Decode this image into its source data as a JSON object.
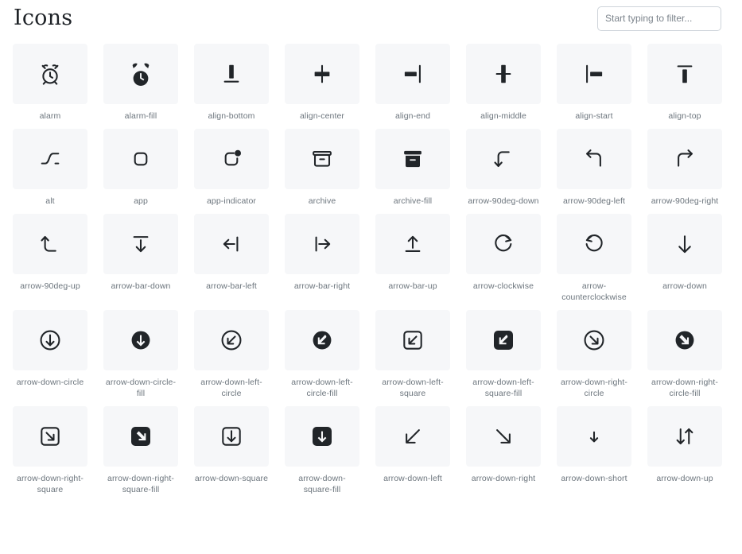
{
  "header": {
    "title": "Icons",
    "filter_placeholder": "Start typing to filter...",
    "filter_value": ""
  },
  "theme": {
    "page_bg": "#ffffff",
    "tile_bg": "#f6f7f9",
    "icon_color": "#212529",
    "label_color": "#6c757d",
    "title_color": "#1f2328",
    "input_border": "#ced4da"
  },
  "grid": {
    "columns": 8,
    "icons": [
      {
        "name": "alarm",
        "glyph": "alarm"
      },
      {
        "name": "alarm-fill",
        "glyph": "alarm-fill"
      },
      {
        "name": "align-bottom",
        "glyph": "align-bottom"
      },
      {
        "name": "align-center",
        "glyph": "align-center"
      },
      {
        "name": "align-end",
        "glyph": "align-end"
      },
      {
        "name": "align-middle",
        "glyph": "align-middle"
      },
      {
        "name": "align-start",
        "glyph": "align-start"
      },
      {
        "name": "align-top",
        "glyph": "align-top"
      },
      {
        "name": "alt",
        "glyph": "alt"
      },
      {
        "name": "app",
        "glyph": "app"
      },
      {
        "name": "app-indicator",
        "glyph": "app-indicator"
      },
      {
        "name": "archive",
        "glyph": "archive"
      },
      {
        "name": "archive-fill",
        "glyph": "archive-fill"
      },
      {
        "name": "arrow-90deg-down",
        "glyph": "arrow-90deg-down"
      },
      {
        "name": "arrow-90deg-left",
        "glyph": "arrow-90deg-left"
      },
      {
        "name": "arrow-90deg-right",
        "glyph": "arrow-90deg-right"
      },
      {
        "name": "arrow-90deg-up",
        "glyph": "arrow-90deg-up"
      },
      {
        "name": "arrow-bar-down",
        "glyph": "arrow-bar-down"
      },
      {
        "name": "arrow-bar-left",
        "glyph": "arrow-bar-left"
      },
      {
        "name": "arrow-bar-right",
        "glyph": "arrow-bar-right"
      },
      {
        "name": "arrow-bar-up",
        "glyph": "arrow-bar-up"
      },
      {
        "name": "arrow-clockwise",
        "glyph": "arrow-clockwise"
      },
      {
        "name": "arrow-counterclockwise",
        "glyph": "arrow-counterclockwise"
      },
      {
        "name": "arrow-down",
        "glyph": "arrow-down"
      },
      {
        "name": "arrow-down-circle",
        "glyph": "arrow-down-circle"
      },
      {
        "name": "arrow-down-circle-fill",
        "glyph": "arrow-down-circle-fill"
      },
      {
        "name": "arrow-down-left-circle",
        "glyph": "arrow-down-left-circle"
      },
      {
        "name": "arrow-down-left-circle-fill",
        "glyph": "arrow-down-left-circle-fill"
      },
      {
        "name": "arrow-down-left-square",
        "glyph": "arrow-down-left-square"
      },
      {
        "name": "arrow-down-left-square-fill",
        "glyph": "arrow-down-left-square-fill"
      },
      {
        "name": "arrow-down-right-circle",
        "glyph": "arrow-down-right-circle"
      },
      {
        "name": "arrow-down-right-circle-fill",
        "glyph": "arrow-down-right-circle-fill"
      },
      {
        "name": "arrow-down-right-square",
        "glyph": "arrow-down-right-square"
      },
      {
        "name": "arrow-down-right-square-fill",
        "glyph": "arrow-down-right-square-fill"
      },
      {
        "name": "arrow-down-square",
        "glyph": "arrow-down-square"
      },
      {
        "name": "arrow-down-square-fill",
        "glyph": "arrow-down-square-fill"
      },
      {
        "name": "arrow-down-left",
        "glyph": "arrow-down-left"
      },
      {
        "name": "arrow-down-right",
        "glyph": "arrow-down-right"
      },
      {
        "name": "arrow-down-short",
        "glyph": "arrow-down-short"
      },
      {
        "name": "arrow-down-up",
        "glyph": "arrow-down-up"
      }
    ]
  }
}
